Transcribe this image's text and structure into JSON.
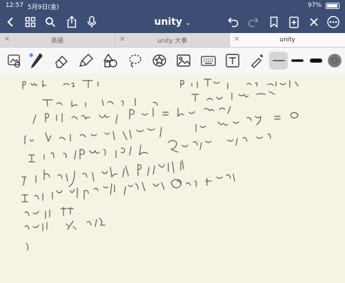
{
  "status": {
    "time": "12:57",
    "date": "5月9日(金)",
    "battery": "97%"
  },
  "toolbar": {
    "title": "unity"
  },
  "tabs": [
    {
      "label": "英語"
    },
    {
      "label": "unity 大事"
    },
    {
      "label": "unity"
    }
  ],
  "icons": {
    "back": "chevron-left-icon",
    "grid": "grid-icon",
    "search": "search-icon",
    "share": "share-icon",
    "mic": "microphone-icon",
    "undo": "undo-icon",
    "redo": "redo-icon",
    "bookmark": "bookmark-icon",
    "add_page": "add-page-icon",
    "close": "close-icon",
    "more": "more-icon"
  },
  "tools": [
    "lasso-image-tool",
    "pen-tool",
    "eraser-tool",
    "highlighter-tool",
    "shapes-tool",
    "lasso-tool",
    "sticker-tool",
    "image-tool",
    "keyboard-tool",
    "text-tool",
    "laser-pointer-tool"
  ],
  "colors": {
    "bar": "#3c4e73",
    "paper": "#f6f3e4",
    "ink": "#5a5a5a",
    "pen_blue": "#2a7fff"
  }
}
